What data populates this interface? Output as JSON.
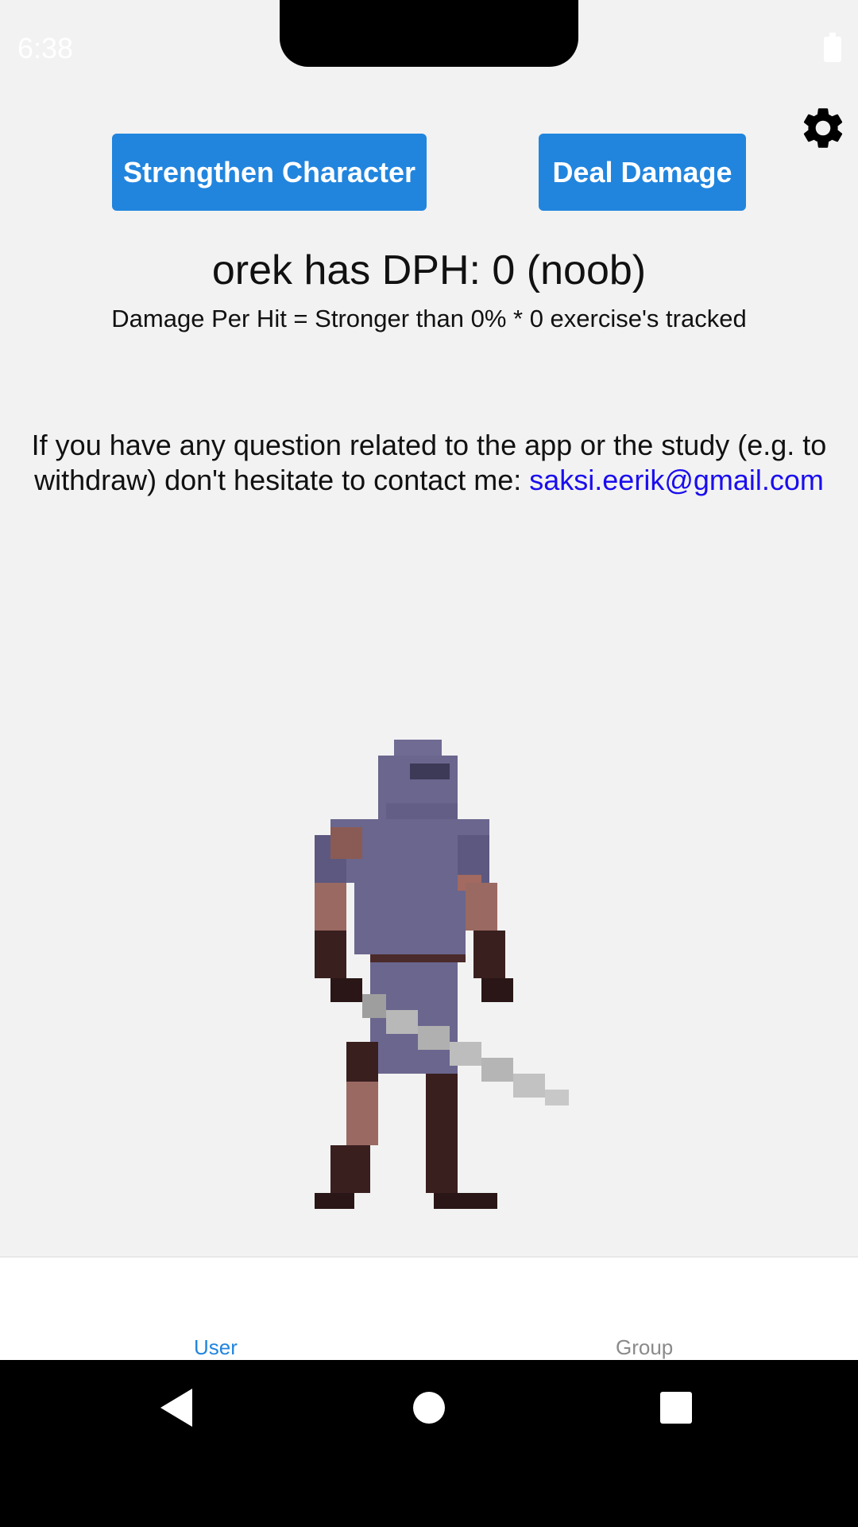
{
  "status_bar": {
    "time": "6:38",
    "battery_icon": "battery-full-icon"
  },
  "actions": {
    "strengthen_label": "Strengthen Character",
    "deal_damage_label": "Deal Damage",
    "settings_icon": "gear-icon"
  },
  "stats": {
    "title": "orek has DPH: 0 (noob)",
    "subtitle": "Damage Per Hit = Stronger than 0% * 0 exercise's tracked"
  },
  "contact": {
    "text": "If you have any question related to the app or the study (e.g. to withdraw) don't hesitate to contact me: ",
    "email": "saksi.eerik@gmail.com"
  },
  "character": {
    "sprite_name": "pixel-knight-sprite"
  },
  "tabs": [
    {
      "label": "User",
      "active": true
    },
    {
      "label": "Group",
      "active": false
    }
  ],
  "nav": {
    "back_icon": "back-triangle-icon",
    "home_icon": "home-circle-icon",
    "recents_icon": "recents-square-icon"
  },
  "colors": {
    "accent": "#2185de",
    "link": "#1a0dee",
    "background": "#f2f2f2"
  }
}
